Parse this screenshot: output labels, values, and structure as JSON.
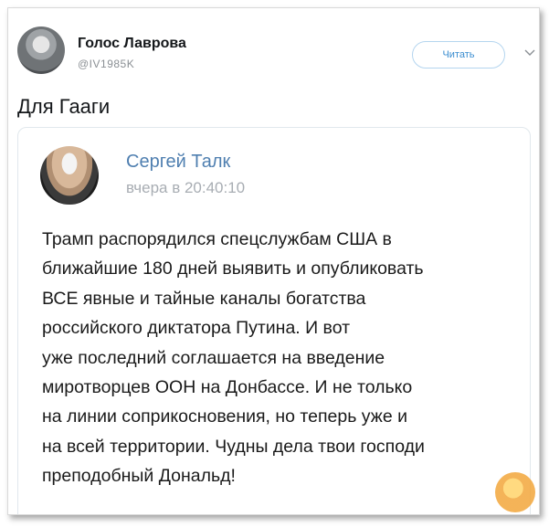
{
  "tweet": {
    "author_name": "Голос Лаврова",
    "author_handle": "@IV1985K",
    "follow_button_label": "Читать",
    "text": "Для Гааги"
  },
  "quote": {
    "name": "Сергей Талк",
    "time": "вчера в 20:40:10",
    "lines": [
      "Трамп распорядился спецслужбам США в",
      "ближайшие 180 дней выявить и опубликовать",
      "ВСЕ явные и тайные каналы богатства",
      "российского диктатора Путина. И вот",
      "уже последний соглашается на введение",
      "миротворцев ООН на Донбассе. И не только",
      "на линии соприкосновения, но теперь уже и",
      "на всей территории. Чудны дела твои господи",
      "преподобный Дональд!"
    ]
  },
  "icons": {
    "chevron": "chevron-down-icon"
  },
  "colors": {
    "name_link": "#4f7fb0",
    "button_text": "#3a8dd0",
    "button_border": "#b4d5ef"
  }
}
